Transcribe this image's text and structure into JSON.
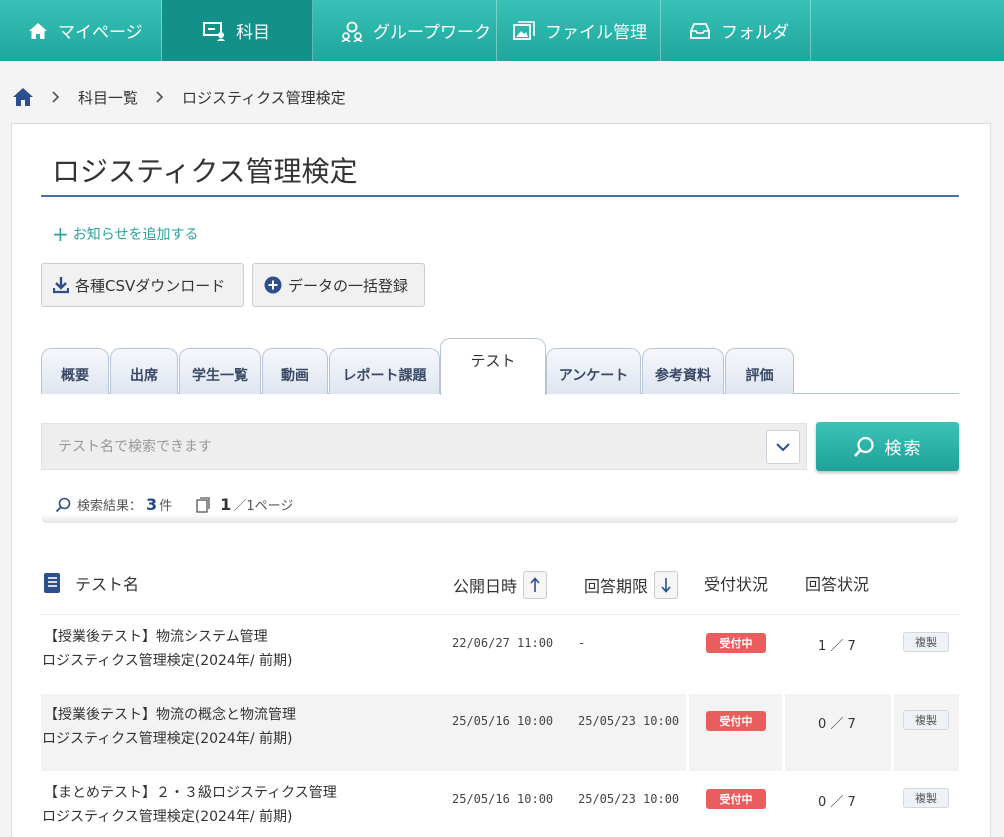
{
  "nav": [
    {
      "label": "マイページ",
      "icon": "home-icon"
    },
    {
      "label": "科目",
      "icon": "presentation-icon"
    },
    {
      "label": "グループワーク",
      "icon": "group-icon"
    },
    {
      "label": "ファイル管理",
      "icon": "image-file-icon"
    },
    {
      "label": "フォルダ",
      "icon": "inbox-icon"
    }
  ],
  "breadcrumb": {
    "level1": "科目一覧",
    "level2": "ロジスティクス管理検定"
  },
  "page": {
    "title": "ロジスティクス管理検定",
    "add_notice": "お知らせを追加する",
    "csv_button": "各種CSVダウンロード",
    "bulk_button": "データの一括登録"
  },
  "tabs": [
    "概要",
    "出席",
    "学生一覧",
    "動画",
    "レポート課題",
    "テスト",
    "アンケート",
    "参考資料",
    "評価"
  ],
  "active_tab": "テスト",
  "search": {
    "placeholder": "テスト名で検索できます",
    "button": "検索"
  },
  "results": {
    "prefix": "検索結果：",
    "count": "3",
    "unit": "件",
    "page": "1",
    "page_suffix": "／1ページ"
  },
  "table": {
    "headers": {
      "name": "テスト名",
      "publish": "公開日時",
      "deadline": "回答期限",
      "reception": "受付状況",
      "answers": "回答状況"
    },
    "rows": [
      {
        "title": "【授業後テスト】物流システム管理",
        "course": "ロジスティクス管理検定(2024年/ 前期)",
        "publish": "22/06/27 11:00",
        "deadline": "-",
        "status": "受付中",
        "answers": "1 ／ 7",
        "copy": "複製"
      },
      {
        "title": "【授業後テスト】物流の概念と物流管理",
        "course": "ロジスティクス管理検定(2024年/ 前期)",
        "publish": "25/05/16 10:00",
        "deadline": "25/05/23 10:00",
        "status": "受付中",
        "answers": "0 ／ 7",
        "copy": "複製"
      },
      {
        "title": "【まとめテスト】２・３級ロジスティクス管理",
        "course": "ロジスティクス管理検定(2024年/ 前期)",
        "publish": "25/05/16 10:00",
        "deadline": "25/05/23 10:00",
        "status": "受付中",
        "answers": "0 ／ 7",
        "copy": "複製"
      }
    ]
  },
  "colors": {
    "teal": "#20a79d",
    "active_nav": "#139189",
    "badge": "#e95d5d",
    "title_rule": "#4a6fa8"
  }
}
